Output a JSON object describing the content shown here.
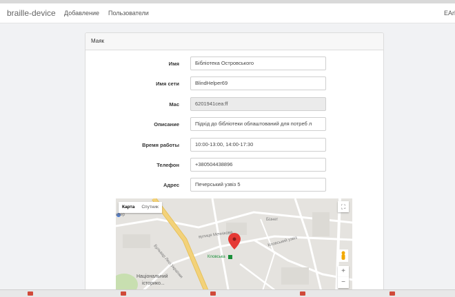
{
  "navbar": {
    "brand": "braille-device",
    "links": [
      "Добавление",
      "Пользователи"
    ],
    "right_text": "EArl"
  },
  "panel": {
    "title": "Маяк",
    "fields": [
      {
        "label": "Имя",
        "value": "Бібліотека Островського",
        "readonly": false
      },
      {
        "label": "Имя сети",
        "value": "BlindHelper69",
        "readonly": false
      },
      {
        "label": "Mac",
        "value": "6201941cea:ff",
        "readonly": true
      },
      {
        "label": "Описание",
        "value": "Підхід до бібліотеки облаштований для потреб л",
        "readonly": false
      },
      {
        "label": "Время работы",
        "value": "10:00-13:00, 14:00-17:30",
        "readonly": false
      },
      {
        "label": "Телефон",
        "value": "+380504438896",
        "readonly": false
      },
      {
        "label": "Адрес",
        "value": "Печерський узвіз 5",
        "readonly": false
      }
    ]
  },
  "map": {
    "tabs": [
      "Карта",
      "Спутник"
    ],
    "active_tab": "Карта",
    "labels": {
      "boulevard": "Бульвар Лесі Українки",
      "street1": "вулиця Мечнікова",
      "metro": "Кловська",
      "museum1": "Національний",
      "museum2": "історико...",
      "street2": "Кловський узвіз",
      "street3": "Бізнет",
      "edge": "ивер"
    },
    "controls": {
      "fullscreen": "⛶",
      "zoom_in": "+",
      "zoom_out": "−"
    },
    "colors": {
      "marker": "#e53935",
      "road_major": "#f3d27a",
      "park": "#c8dfb0"
    }
  }
}
